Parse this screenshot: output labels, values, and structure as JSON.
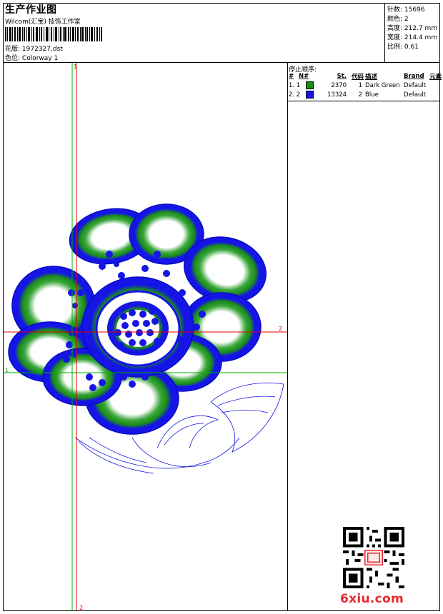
{
  "header": {
    "title": "生产作业图",
    "studio": "Wilcom(汇宝) 技饰工作室",
    "design_label": "花版:",
    "design_value": "1972327.dst",
    "colorway_label": "色位:",
    "colorway_value": "Colorway 1"
  },
  "stats": [
    {
      "label": "针数:",
      "value": "15696"
    },
    {
      "label": "颜色:",
      "value": "2"
    },
    {
      "label": "高度:",
      "value": "212.7 mm"
    },
    {
      "label": "宽度:",
      "value": "214.4 mm"
    },
    {
      "label": "比例:",
      "value": "0.61"
    }
  ],
  "stops": {
    "title": "停止顺序:",
    "columns": [
      "#",
      "N#",
      "St.",
      "代码",
      "描述",
      "Brand",
      "元素"
    ],
    "rows": [
      {
        "num": "1. 1",
        "color": "#1a8c1a",
        "stitches": "2370",
        "code": "1",
        "desc": "Dark Green",
        "brand": "Default"
      },
      {
        "num": "2. 2",
        "color": "#1515e6",
        "stitches": "13324",
        "code": "2",
        "desc": "Blue",
        "brand": "Default"
      }
    ]
  },
  "axes": {
    "v_green": "1",
    "v_red": "2",
    "h_red": "2",
    "h_green": "1"
  },
  "watermark": "6xiu.com",
  "colors": {
    "blue": "#1515e6",
    "green": "#1a8c1a",
    "red": "#e8282f"
  }
}
